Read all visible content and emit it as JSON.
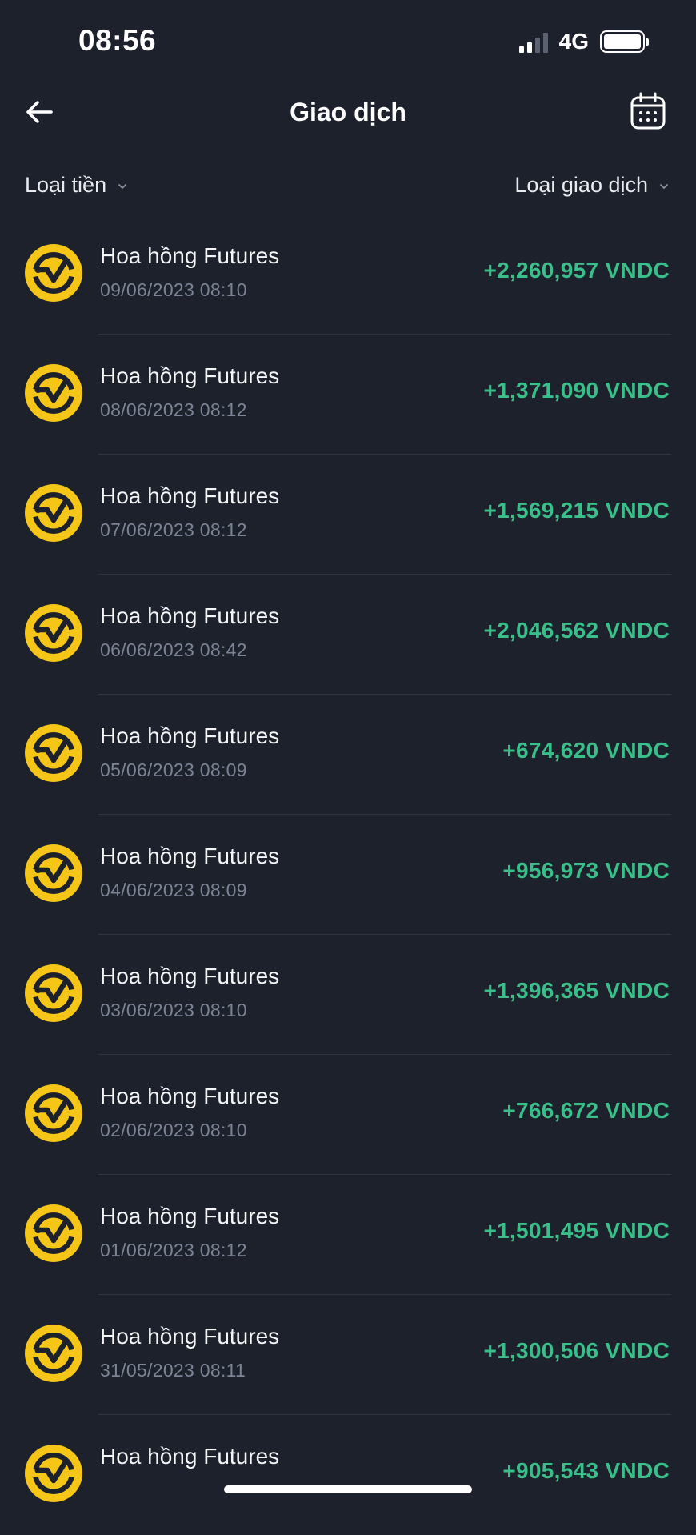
{
  "status_bar": {
    "time": "08:56",
    "network": "4G",
    "signal_bars": 2,
    "battery_percent": 95
  },
  "header": {
    "title": "Giao dịch",
    "back_icon": "arrow-left-icon",
    "calendar_icon": "calendar-icon"
  },
  "filters": {
    "currency_label": "Loại tiền",
    "type_label": "Loại giao dịch"
  },
  "colors": {
    "background": "#1c212b",
    "amount_positive": "#3bbf8a",
    "coin_yellow": "#f5c518",
    "date_gray": "#7b8394"
  },
  "transactions": [
    {
      "title": "Hoa hồng Futures",
      "date": "09/06/2023 08:10",
      "amount": "+2,260,957 VNDC"
    },
    {
      "title": "Hoa hồng Futures",
      "date": "08/06/2023 08:12",
      "amount": "+1,371,090 VNDC"
    },
    {
      "title": "Hoa hồng Futures",
      "date": "07/06/2023 08:12",
      "amount": "+1,569,215 VNDC"
    },
    {
      "title": "Hoa hồng Futures",
      "date": "06/06/2023 08:42",
      "amount": "+2,046,562 VNDC"
    },
    {
      "title": "Hoa hồng Futures",
      "date": "05/06/2023 08:09",
      "amount": "+674,620 VNDC"
    },
    {
      "title": "Hoa hồng Futures",
      "date": "04/06/2023 08:09",
      "amount": "+956,973 VNDC"
    },
    {
      "title": "Hoa hồng Futures",
      "date": "03/06/2023 08:10",
      "amount": "+1,396,365 VNDC"
    },
    {
      "title": "Hoa hồng Futures",
      "date": "02/06/2023 08:10",
      "amount": "+766,672 VNDC"
    },
    {
      "title": "Hoa hồng Futures",
      "date": "01/06/2023 08:12",
      "amount": "+1,501,495 VNDC"
    },
    {
      "title": "Hoa hồng Futures",
      "date": "31/05/2023 08:11",
      "amount": "+1,300,506 VNDC"
    },
    {
      "title": "Hoa hồng Futures",
      "date": "",
      "amount": "+905,543 VNDC"
    }
  ]
}
